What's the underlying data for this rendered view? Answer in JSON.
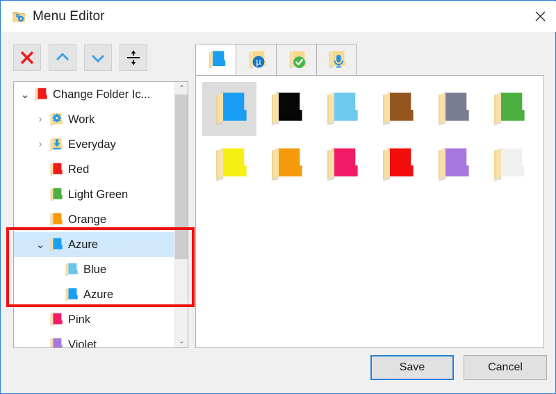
{
  "window": {
    "title": "Menu Editor",
    "title_icon": "folder-gear-icon",
    "close_label": "✕",
    "accent": "#2a7fd4"
  },
  "toolbar": {
    "buttons": [
      {
        "name": "delete-button",
        "icon": "red-x-icon",
        "label": "Delete"
      },
      {
        "name": "move-up-button",
        "icon": "chevron-up-icon",
        "label": "Move Up"
      },
      {
        "name": "move-down-button",
        "icon": "chevron-down-icon",
        "label": "Move Down"
      },
      {
        "name": "separator-button",
        "icon": "up-down-arrows-icon",
        "label": "Add Separator"
      }
    ]
  },
  "tree": {
    "items": [
      {
        "label": "Change Folder Ic...",
        "indent": 0,
        "chevron": "expanded",
        "icon_color": "#ef1b1b",
        "selected": false
      },
      {
        "label": "Work",
        "indent": 1,
        "chevron": "collapsed",
        "icon_color": "#f7d58a",
        "badge": "gear",
        "selected": false
      },
      {
        "label": "Everyday",
        "indent": 1,
        "chevron": "collapsed",
        "icon_color": "#f7d58a",
        "badge": "download",
        "selected": false
      },
      {
        "label": "Red",
        "indent": 1,
        "chevron": "none",
        "icon_color": "#ef1b1b",
        "selected": false
      },
      {
        "label": "Light Green",
        "indent": 1,
        "chevron": "none",
        "icon_color": "#4caf3f",
        "selected": false
      },
      {
        "label": "Orange",
        "indent": 1,
        "chevron": "none",
        "icon_color": "#f79a0c",
        "selected": false
      },
      {
        "label": "Azure",
        "indent": 1,
        "chevron": "expanded",
        "icon_color": "#189ef3",
        "selected": true
      },
      {
        "label": "Blue",
        "indent": 2,
        "chevron": "none",
        "icon_color": "#66c6ef",
        "selected": false
      },
      {
        "label": "Azure",
        "indent": 2,
        "chevron": "none",
        "icon_color": "#189ef3",
        "selected": false
      },
      {
        "label": "Pink",
        "indent": 1,
        "chevron": "none",
        "icon_color": "#f31b66",
        "selected": false
      },
      {
        "label": "Violet",
        "indent": 1,
        "chevron": "none",
        "icon_color": "#a779e0",
        "selected": false
      }
    ],
    "scrollbar": {
      "up_arrow": "⌃",
      "down_arrow": "⌄"
    }
  },
  "tabs": [
    {
      "name": "tab-plain-folders",
      "icon": "blue-folder-icon",
      "active": true
    },
    {
      "name": "tab-utorrent",
      "icon": "folder-utorrent-badge-icon",
      "active": false
    },
    {
      "name": "tab-checked",
      "icon": "folder-check-badge-icon",
      "active": false
    },
    {
      "name": "tab-microphone",
      "icon": "folder-microphone-badge-icon",
      "active": false
    }
  ],
  "icon_grid": [
    {
      "name": "folder-azure",
      "color": "#189ef3",
      "selected": true
    },
    {
      "name": "folder-black",
      "color": "#070707",
      "selected": false
    },
    {
      "name": "folder-light-blue",
      "color": "#6ec9ee",
      "selected": false
    },
    {
      "name": "folder-brown",
      "color": "#95551f",
      "selected": false
    },
    {
      "name": "folder-grey",
      "color": "#7b7d93",
      "selected": false
    },
    {
      "name": "folder-green",
      "color": "#4caf3f",
      "selected": false
    },
    {
      "name": "folder-yellow",
      "color": "#f6ef16",
      "selected": false
    },
    {
      "name": "folder-orange",
      "color": "#f59a0b",
      "selected": false
    },
    {
      "name": "folder-pink",
      "color": "#f31b66",
      "selected": false
    },
    {
      "name": "folder-red",
      "color": "#f30c0c",
      "selected": false
    },
    {
      "name": "folder-violet",
      "color": "#a779e0",
      "selected": false
    },
    {
      "name": "folder-white",
      "color": "#f0f0f0",
      "selected": false
    }
  ],
  "footer": {
    "save_label": "Save",
    "cancel_label": "Cancel"
  },
  "annotation": {
    "color": "#ee1111",
    "target": "azure-subtree"
  }
}
